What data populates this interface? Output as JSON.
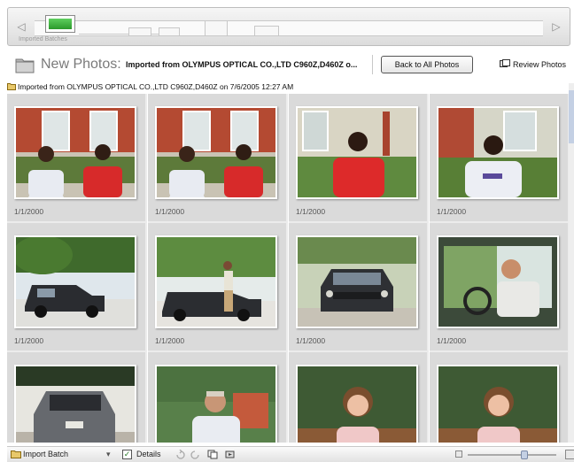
{
  "timeline": {
    "caption": "Imported Batches"
  },
  "header": {
    "title": "New Photos:",
    "subtitle": "Imported from OLYMPUS OPTICAL CO.,LTD C960Z,D460Z o...",
    "back_label": "Back to All Photos",
    "review_label": "Review Photos"
  },
  "group": {
    "label": "Imported from OLYMPUS OPTICAL CO.,LTD C960Z,D460Z on 7/6/2005 12:27 AM"
  },
  "photos": [
    {
      "date": "1/1/2000",
      "scene": "two-people"
    },
    {
      "date": "1/1/2000",
      "scene": "two-people"
    },
    {
      "date": "1/1/2000",
      "scene": "one-person-red"
    },
    {
      "date": "1/1/2000",
      "scene": "one-person-white"
    },
    {
      "date": "1/1/2000",
      "scene": "car"
    },
    {
      "date": "1/1/2000",
      "scene": "car-person"
    },
    {
      "date": "1/1/2000",
      "scene": "car-front"
    },
    {
      "date": "1/1/2000",
      "scene": "car-driver"
    },
    {
      "date": "",
      "scene": "car-rear"
    },
    {
      "date": "",
      "scene": "man-portrait"
    },
    {
      "date": "",
      "scene": "woman-portrait"
    },
    {
      "date": "",
      "scene": "woman-portrait"
    }
  ],
  "bottombar": {
    "batch_label": "Import Batch",
    "details_label": "Details",
    "details_checked": true
  },
  "colors": {
    "accent": "#2b9a2b",
    "selection": "#c4d0e4"
  }
}
